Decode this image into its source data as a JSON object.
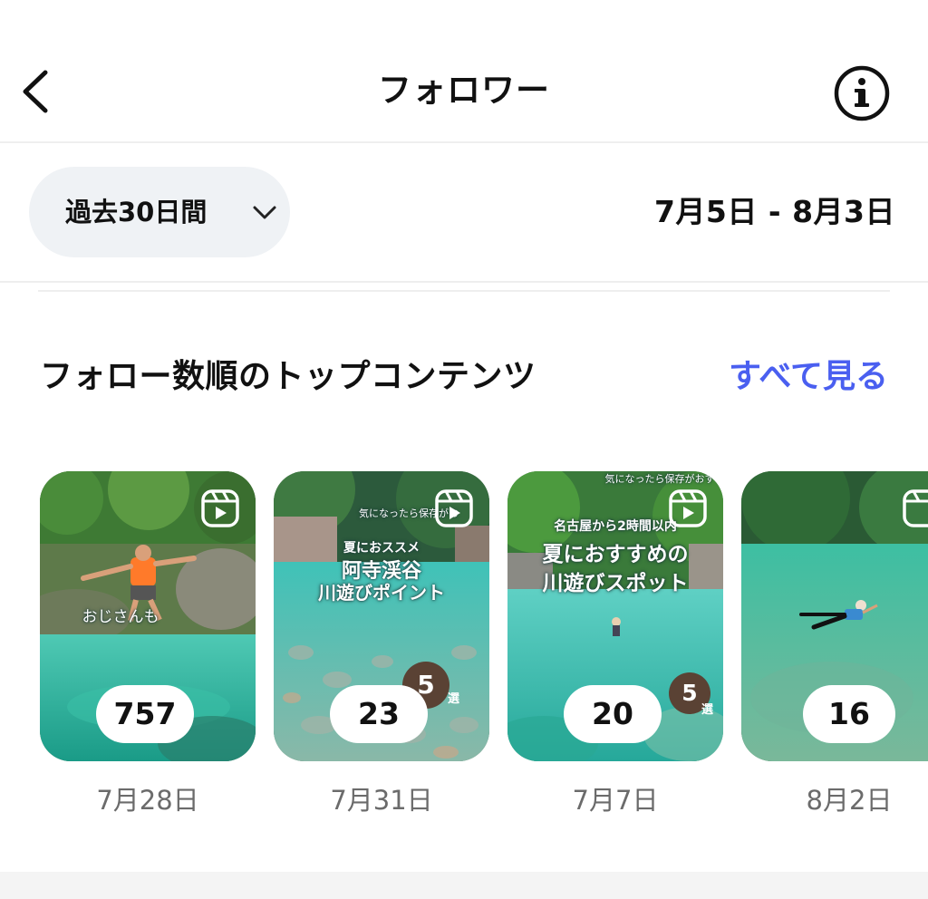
{
  "header": {
    "title": "フォロワー",
    "back_icon": "chevron-left-icon",
    "info_icon": "info-icon"
  },
  "date_filter": {
    "range_label": "過去30日間",
    "range_icon": "chevron-down-icon",
    "date_span": "7月5日 - 8月3日"
  },
  "section": {
    "title": "フォロー数順のトップコンテンツ",
    "see_all_label": "すべて見る",
    "see_all_color": "#4a5ff0"
  },
  "cards": [
    {
      "count": "757",
      "date": "7月28日",
      "caption": "おじさんも"
    },
    {
      "count": "23",
      "date": "7月31日",
      "top_text": "気になったら保存がお",
      "tag": "夏におススメ",
      "title_line1": "阿寺渓谷",
      "title_line2": "川遊びポイント",
      "badge": "5",
      "badge_sub": "選"
    },
    {
      "count": "20",
      "date": "7月7日",
      "top_text": "気になったら保存がおすすめ",
      "tag": "名古屋から2時間以内",
      "title_line1": "夏におすすめの",
      "title_line2": "川遊びスポット",
      "badge": "5",
      "badge_sub": "選"
    },
    {
      "count": "16",
      "date": "8月2日"
    }
  ]
}
